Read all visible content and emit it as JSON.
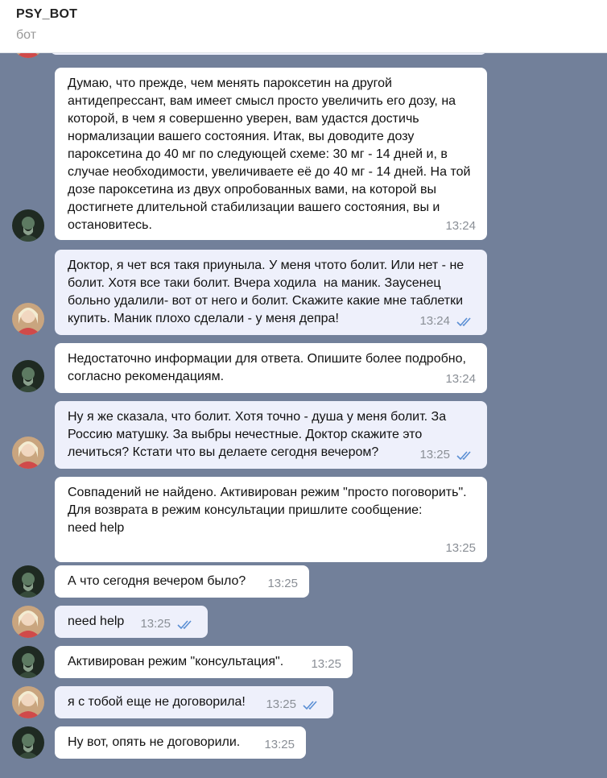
{
  "header": {
    "title": "PSY_BOT",
    "subtitle": "бот"
  },
  "colors": {
    "chat_bg": "#72809a",
    "incoming_bubble": "#ffffff",
    "outgoing_bubble": "#eef0fb",
    "check": "#5b8fd4"
  },
  "messages": [
    {
      "sender": "bot",
      "text": "Думаю, что прежде, чем менять пароксетин на другой антидепрессант, вам имеет смысл просто увеличить его дозу, на которой, в чем я совершенно уверен, вам удастся достичь нормализации вашего состояния. Итак, вы доводите дозу пароксетина до 40 мг по следующей схеме: 30 мг - 14 дней и, в случае необходимости, увеличиваете её до 40 мг - 14 дней. На той дозе пароксетина из двух опробованных вами, на которой вы достигнете длительной стабилизации вашего состояния, вы и остановитесь.",
      "time": "13:24"
    },
    {
      "sender": "user",
      "text": "Доктор, я чет вся такя приуныла. У меня чтото болит. Или нет - не болит. Хотя все таки болит. Вчера ходила  на маник. Заусенец больно удалили- вот от него и болит. Скажите какие мне таблетки купить. Маник плохо сделали - у меня депра!",
      "time": "13:24",
      "read": true
    },
    {
      "sender": "bot",
      "text": "Недостаточно информации для ответа. Опишите более подробно, согласно рекомендациям.",
      "time": "13:24"
    },
    {
      "sender": "user",
      "text": "Ну я же сказала, что болит. Хотя точно - душа у меня болит. За Россию матушку. За выбры нечестные. Доктор скажите это лечиться? Кстати что вы делаете сегодня вечером?",
      "time": "13:25",
      "read": true
    },
    {
      "sender": "bot",
      "text": "Совпадений не найдено. Активирован режим \"просто поговорить\". Для возврата в режим консультации пришлите сообщение:\nneed help",
      "time": "13:25"
    },
    {
      "sender": "bot",
      "text": "А что сегодня вечером было?",
      "time": "13:25"
    },
    {
      "sender": "user",
      "text": "need help",
      "time": "13:25",
      "read": true
    },
    {
      "sender": "bot",
      "text": "Активирован режим \"консультация\".",
      "time": "13:25"
    },
    {
      "sender": "user",
      "text": "я с тобой еще не договорила!",
      "time": "13:25",
      "read": true
    },
    {
      "sender": "bot",
      "text": "Ну вот, опять не договорили.",
      "time": "13:25"
    }
  ]
}
